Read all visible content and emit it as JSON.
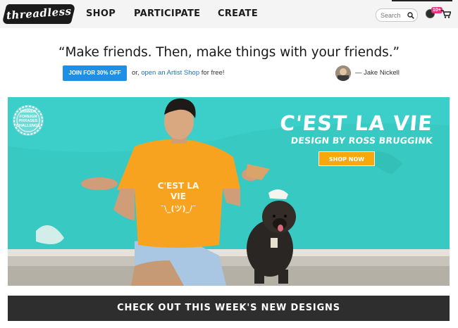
{
  "header": {
    "logo_text": "threadless",
    "nav": [
      {
        "label": "SHOP"
      },
      {
        "label": "PARTICIPATE"
      },
      {
        "label": "CREATE"
      }
    ],
    "search": {
      "placeholder": "Search",
      "value": ""
    },
    "notification_badge": "10+"
  },
  "promo": {
    "quote": "“Make friends. Then, make things with your friends.”",
    "join_button": "JOIN FOR 30% OFF",
    "or_text": "or,",
    "artist_link": "open an Artist Shop",
    "free_text": "for free!",
    "attribution": "— Jake Nickell"
  },
  "hero": {
    "title": "C'EST LA VIE",
    "subtitle": "DESIGN BY ROSS BRUGGINK",
    "shop_button": "SHOP NOW",
    "shirt_text": [
      "C'EST LA",
      "VIE"
    ],
    "seal_lines": [
      "WINNER",
      "FOREIGN",
      "PHRASES",
      "CHALLENGE"
    ],
    "colors": {
      "wall": "#36c8c1",
      "shirt": "#f7a11e",
      "button": "#f7a80a"
    }
  },
  "banner": {
    "label": "CHECK OUT THIS WEEK'S NEW DESIGNS"
  },
  "colors": {
    "accent_blue": "#1d8fe6",
    "badge_pink": "#e6347c",
    "dark": "#2e2e2e"
  }
}
